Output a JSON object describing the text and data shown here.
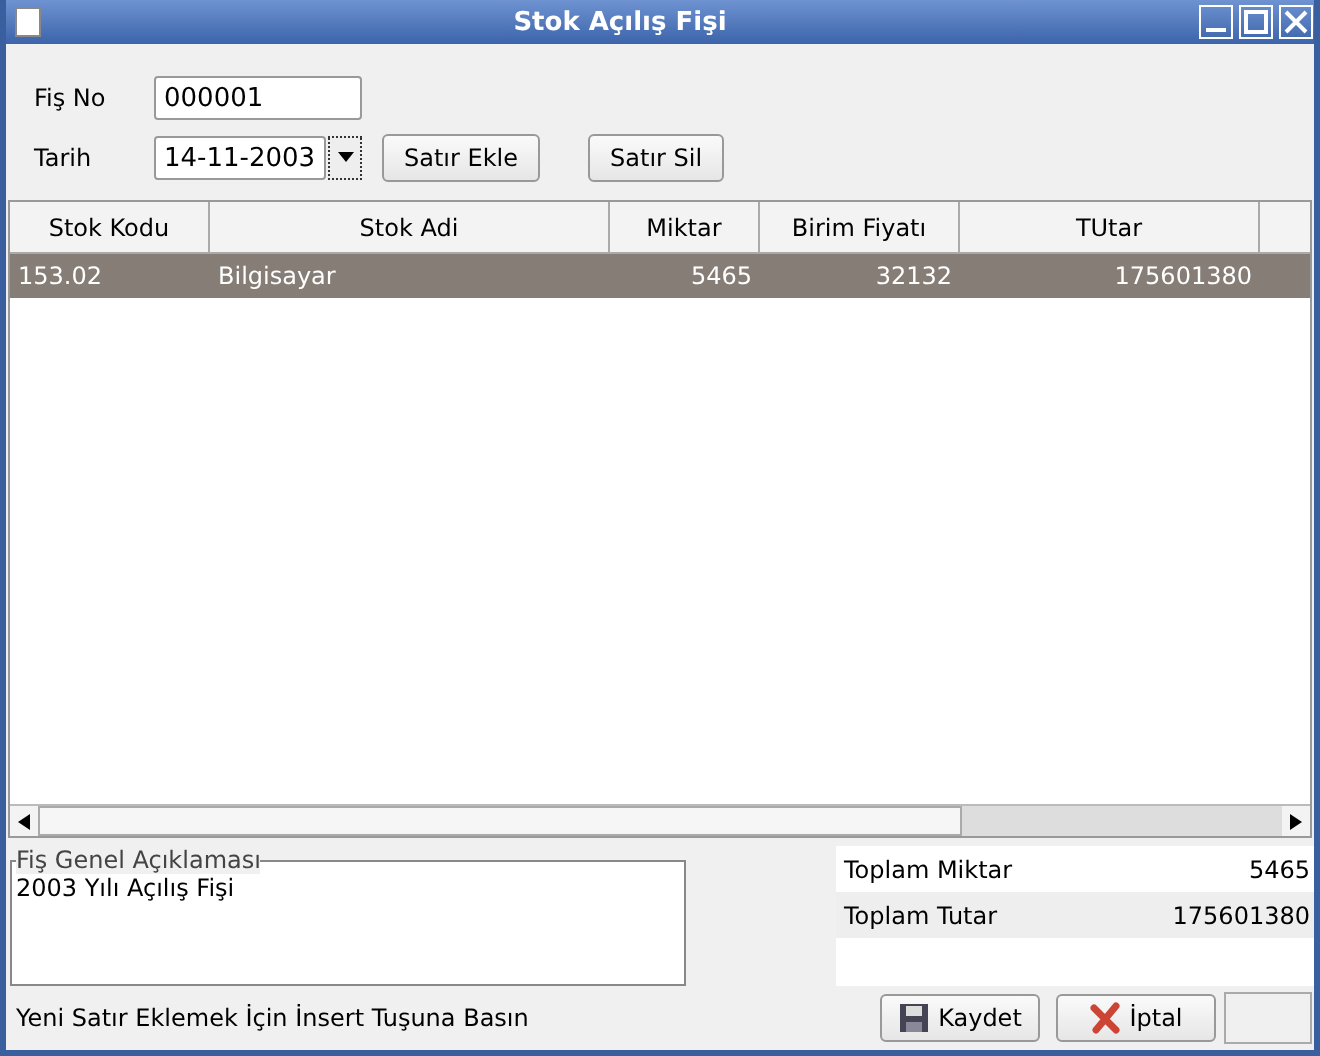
{
  "window": {
    "title": "Stok Açılış Fişi"
  },
  "form": {
    "fis_no": {
      "label": "Fiş No",
      "value": "000001"
    },
    "tarih": {
      "label": "Tarih",
      "value": "14-11-2003"
    },
    "buttons": [
      "Satır Ekle",
      "Satır Sil"
    ]
  },
  "table": {
    "columns": [
      "Stok Kodu",
      "Stok Adi",
      "Miktar",
      "Birim Fiyatı",
      "TUtar"
    ],
    "rows": [
      {
        "cells": [
          "153.02",
          "Bilgisayar",
          "5465",
          "32132",
          "175601380"
        ],
        "selected": true
      }
    ]
  },
  "description": {
    "legend": "Fiş Genel Açıklaması",
    "value": "2003 Yılı Açılış Fişi"
  },
  "totals": [
    {
      "label": "Toplam Miktar",
      "value": "5465"
    },
    {
      "label": "Toplam Tutar",
      "value": "175601380"
    }
  ],
  "status": "Yeni Satır Eklemek İçin İnsert Tuşuna Basın",
  "actions": [
    {
      "kind": "save",
      "label": "Kaydet"
    },
    {
      "kind": "cancel",
      "label": "İptal"
    }
  ]
}
